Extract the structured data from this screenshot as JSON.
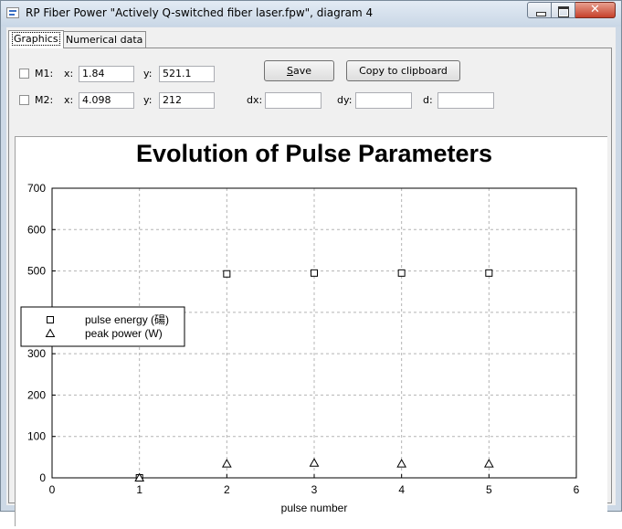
{
  "window": {
    "title": "RP Fiber Power \"Actively Q-switched fiber laser.fpw\", diagram 4",
    "close_glyph": "✕"
  },
  "tabs": [
    {
      "label": "Graphics",
      "active": true
    },
    {
      "label": "Numerical data",
      "active": false
    }
  ],
  "markers": {
    "m1": {
      "label": "M1:",
      "checked": false,
      "x_label": "x:",
      "x_value": "1.84",
      "y_label": "y:",
      "y_value": "521.1"
    },
    "m2": {
      "label": "M2:",
      "checked": false,
      "x_label": "x:",
      "x_value": "4.098",
      "y_label": "y:",
      "y_value": "212"
    },
    "dx_label": "dx:",
    "dx_value": "",
    "dy_label": "dy:",
    "dy_value": "",
    "d_label": "d:",
    "d_value": ""
  },
  "buttons": {
    "save_accel": "S",
    "save_rest": "ave",
    "copy_label": "Copy to clipboard"
  },
  "chart_data": {
    "type": "scatter",
    "title": "Evolution of Pulse Parameters",
    "xlabel": "pulse number",
    "ylabel": "",
    "xlim": [
      0,
      6
    ],
    "ylim": [
      0,
      700
    ],
    "xticks": [
      "0",
      "1",
      "2",
      "3",
      "4",
      "5",
      "6"
    ],
    "yticks": [
      "0",
      "100",
      "200",
      "300",
      "400",
      "500",
      "600",
      "700"
    ],
    "grid": true,
    "legend_position": "center-left",
    "series": [
      {
        "name": "pulse energy (碭)",
        "marker": "square",
        "x": [
          1,
          2,
          3,
          4,
          5
        ],
        "y": [
          0,
          493,
          495,
          495,
          495
        ]
      },
      {
        "name": "peak power (W)",
        "marker": "triangle",
        "x": [
          1,
          2,
          3,
          4,
          5
        ],
        "y": [
          0,
          34,
          36,
          34,
          34
        ]
      }
    ]
  }
}
